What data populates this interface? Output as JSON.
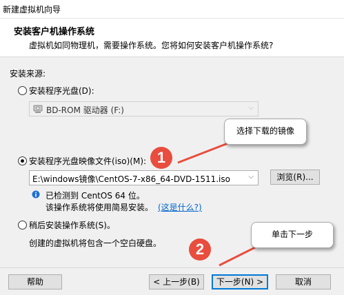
{
  "window": {
    "title": "新建虚拟机向导"
  },
  "header": {
    "title": "安装客户机操作系统",
    "subtitle": "虚拟机如同物理机，需要操作系统。您将如何安装客户机操作系统?"
  },
  "source_label": "安装来源:",
  "options": {
    "disc": {
      "label": "安装程序光盘(D):",
      "drive_value": "BD-ROM 驱动器 (F:)"
    },
    "iso": {
      "label": "安装程序光盘映像文件(iso)(M):",
      "path_value": "E:\\windows镜像\\CentOS-7-x86_64-DVD-1511.iso",
      "browse_label": "浏览(R)...",
      "detected_text": "已检测到 CentOS 64 位。",
      "easy_install_text": "该操作系统将使用简易安装。",
      "help_link": "(这是什么?)"
    },
    "later": {
      "label": "稍后安装操作系统(S)。",
      "description": "创建的虚拟机将包含一个空白硬盘。"
    }
  },
  "footer": {
    "help": "帮助",
    "back": "< 上一步(B)",
    "next": "下一步(N) >",
    "cancel": "取消"
  },
  "annotations": {
    "callout1": "选择下载的镜像",
    "callout2": "单击下一步",
    "step1": "1",
    "step2": "2",
    "accent_color": "#e84d3d"
  },
  "selected_option": "iso"
}
